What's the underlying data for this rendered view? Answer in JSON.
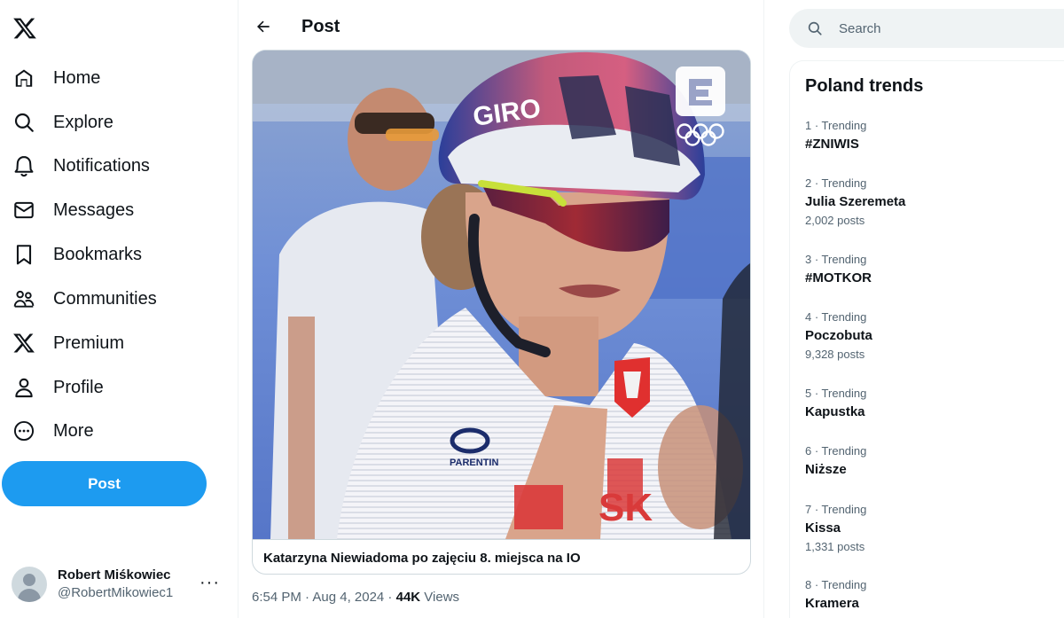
{
  "nav": {
    "logo_icon": "x-logo-icon",
    "items": [
      {
        "label": "Home",
        "icon": "home-icon"
      },
      {
        "label": "Explore",
        "icon": "search-icon"
      },
      {
        "label": "Notifications",
        "icon": "bell-icon"
      },
      {
        "label": "Messages",
        "icon": "envelope-icon"
      },
      {
        "label": "Bookmarks",
        "icon": "bookmark-icon"
      },
      {
        "label": "Communities",
        "icon": "people-icon"
      },
      {
        "label": "Premium",
        "icon": "x-logo-icon"
      },
      {
        "label": "Profile",
        "icon": "person-icon"
      },
      {
        "label": "More",
        "icon": "more-circle-icon"
      }
    ],
    "post_label": "Post"
  },
  "account": {
    "name": "Robert Miśkowiec",
    "handle": "@RobertMikowiec1",
    "more": "···"
  },
  "main": {
    "title": "Post",
    "media_caption": "Katarzyna Niewiadoma po zajęciu 8. miejsca na IO",
    "media_overlay": {
      "helmet_brand": "GIRO",
      "jersey_brand": "PARENTIN",
      "jersey_text": "SK"
    },
    "timestamp": "6:54 PM · Aug 4, 2024 · ",
    "views_count": "44K",
    "views_label": " Views"
  },
  "search": {
    "placeholder": "Search"
  },
  "trends": {
    "title": "Poland trends",
    "items": [
      {
        "meta": "1 · Trending",
        "name": "#ZNIWIS",
        "posts": ""
      },
      {
        "meta": "2 · Trending",
        "name": "Julia Szeremeta",
        "posts": "2,002 posts"
      },
      {
        "meta": "3 · Trending",
        "name": "#MOTKOR",
        "posts": ""
      },
      {
        "meta": "4 · Trending",
        "name": "Poczobuta",
        "posts": "9,328 posts"
      },
      {
        "meta": "5 · Trending",
        "name": "Kapustka",
        "posts": ""
      },
      {
        "meta": "6 · Trending",
        "name": "Niższe",
        "posts": ""
      },
      {
        "meta": "7 · Trending",
        "name": "Kissa",
        "posts": "1,331 posts"
      },
      {
        "meta": "8 · Trending",
        "name": "Kramera",
        "posts": ""
      }
    ]
  },
  "colors": {
    "accent": "#1d9bf0",
    "text_primary": "#0f1419",
    "text_secondary": "#536471",
    "border": "#eff3f4"
  }
}
